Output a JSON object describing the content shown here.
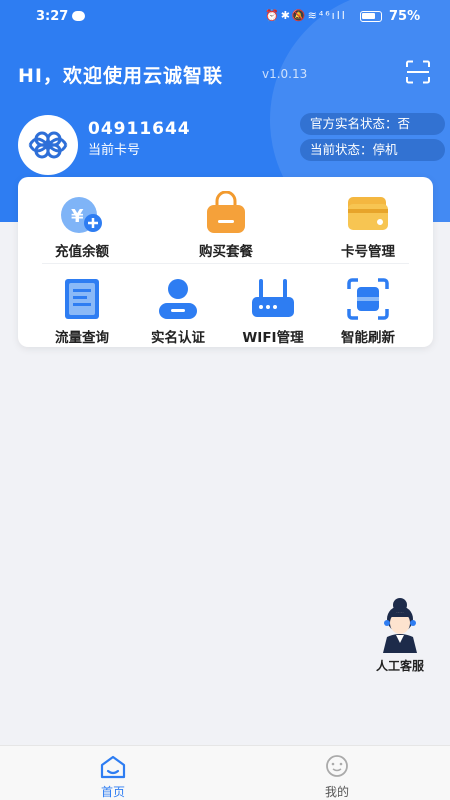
{
  "status_bar": {
    "time": "3:27",
    "icons": [
      "message-icon",
      "alarm-icon",
      "bluetooth-icon",
      "mute-icon",
      "wifi-icon",
      "signal-icon"
    ],
    "sys_icons_glyphs": "⏰✱🔕≋⁴⁶ıll",
    "battery_percent": "75%"
  },
  "header": {
    "welcome": "HI，欢迎使用云诚智联",
    "version": "v1.0.13",
    "scan_icon": "scan-icon",
    "card_number": "04911644",
    "card_label": "当前卡号",
    "real_name_status": "官方实名状态：否",
    "current_status": "当前状态：停机",
    "colors": {
      "primary": "#2e7df2"
    }
  },
  "menu": {
    "items": [
      {
        "label": "充值余额",
        "icon": "recharge-icon"
      },
      {
        "label": "购买套餐",
        "icon": "shopping-bag-icon"
      },
      {
        "label": "卡号管理",
        "icon": "card-icon"
      },
      {
        "label": "流量查询",
        "icon": "document-icon"
      },
      {
        "label": "实名认证",
        "icon": "user-icon"
      },
      {
        "label": "WIFI管理",
        "icon": "router-icon"
      },
      {
        "label": "智能刷新",
        "icon": "scan-refresh-icon"
      }
    ]
  },
  "customer_service": {
    "label": "人工客服",
    "icon": "agent-avatar-icon"
  },
  "tabbar": {
    "items": [
      {
        "label": "首页",
        "icon": "home-icon",
        "active": true
      },
      {
        "label": "我的",
        "icon": "profile-chat-icon",
        "active": false
      }
    ]
  }
}
